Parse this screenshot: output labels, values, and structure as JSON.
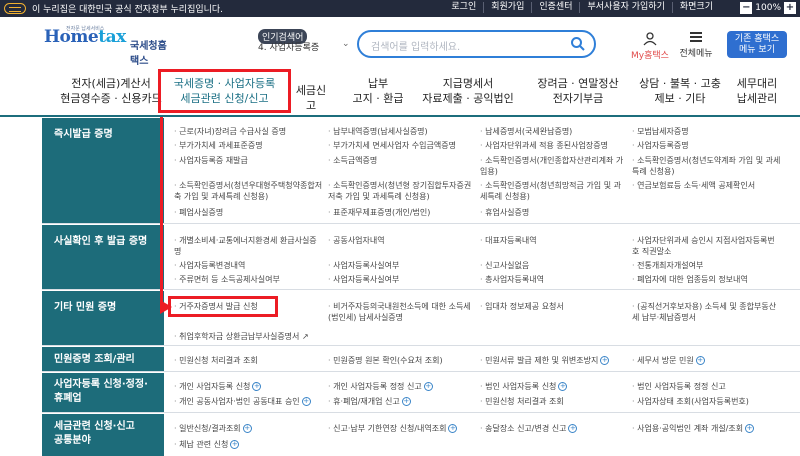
{
  "topbar": {
    "notice": "이 누리집은 대한민국 공식 전자정부 누리집입니다.",
    "links": [
      "로그인",
      "회원가입",
      "인증센터",
      "부서사용자 가입하기",
      "화면크기"
    ],
    "zoom_minus": "−",
    "zoom_value": "100%",
    "zoom_plus": "+"
  },
  "header": {
    "logo_text_home": "Home",
    "logo_text_tax": "tax",
    "logo_sub": "전자문 납세서비스",
    "logo_name": "국세청홈택스",
    "popular_tag": "인기검색어",
    "popular_keyword": "4.  사업자등록증",
    "search_placeholder": "검색어를 입력하세요.",
    "my_hometax": "My홈택스",
    "all_menu": "전체메뉴",
    "old_view_1": "기존 홈택스",
    "old_view_2": "메뉴 보기"
  },
  "nav": [
    {
      "line1": "전자(세금)계산서",
      "line2": "현금영수증 · 신용카드"
    },
    {
      "line1": "국세증명 · 사업자등록",
      "line2": "세금관련 신청/신고"
    },
    {
      "line1": "세금신고",
      "line2": ""
    },
    {
      "line1": "납부",
      "line2": "고지 · 환급"
    },
    {
      "line1": "지급명세서",
      "line2": "자료제출 · 공익법인"
    },
    {
      "line1": "장려금 · 연말정산",
      "line2": "전자기부금"
    },
    {
      "line1": "상담 · 불복 · 고충",
      "line2": "제보 · 기타"
    },
    {
      "line1": "세무대리",
      "line2": "납세관리"
    }
  ],
  "sections": {
    "s1": {
      "title": "즉시발급 증명",
      "items": [
        "근로(자녀)장려금 수급사실 증명",
        "납부내역증명(납세사실증명)",
        "납세증명서(국세완납증명)",
        "모범납세자증명",
        "부가가치세 과세표준증명",
        "부가가치세 면세사업자 수입금액증명",
        "사업자단위과세 적용 종된사업장증명",
        "사업자등록증명",
        "사업자등록증 재발급",
        "소득금액증명",
        "소득확인증명서(개인종합자산관리계좌 가입용)",
        "소득확인증명서(청년도약계좌 가입 및 과세특례 신청용)",
        "소득확인증명서(청년우대형주택청약종합저축 가입 및 과세특례 신청용)",
        "소득확인증명서(청년형 장기집합투자증권저축 가입 및 과세특례 신청용)",
        "소득확인증명서(청년희망적금 가입 및 과세특례 신청용)",
        "연금보험료등 소득·세액 공제확인서",
        "폐업사실증명",
        "표준재무제표증명(개인/법인)",
        "휴업사실증명"
      ]
    },
    "s2": {
      "title": "사실확인 후 발급 증명",
      "items": [
        "개별소비세·교통에너지환경세 환급사실증명",
        "공동사업자내역",
        "대표자등록내역",
        "사업자단위과세 승인시 지점사업자등록번호 직권말소",
        "사업자등록변경내역",
        "사업자등록사실여부",
        "신고사실없음",
        "전통개최자개설여부",
        "주류면허 등 소득공제사실여부",
        "사업자등록사실여부",
        "총사업자등록내역",
        "폐업자에 대한 업종등의 정보내역"
      ]
    },
    "s3": {
      "title": "기타 민원 증명",
      "items": [
        "거주자증명서 발급 신청",
        "비거주자등의국내원천소득에 대한 소득세(법인세) 납세사실증명",
        "임대차 정보제공 요청서",
        "(공직선거후보자용) 소득세 및 종합부동산세 납부·체납증명서",
        "취업후학자금 상환금납부사실증명서"
      ]
    },
    "s4": {
      "title": "민원증명 조회/관리",
      "items": [
        "민원신청 처리결과 조회",
        "민원증명 원본 확인(수요처 조회)",
        "민원서류 발급 제한 및 위변조방지",
        "세무서 방문 민원"
      ]
    },
    "s5": {
      "title_1": "사업자등록 신청·정정·",
      "title_2": "휴폐업",
      "items": [
        "개인 사업자등록 신청",
        "개인 사업자등록 정정 신고",
        "법인 사업자등록 신청",
        "법인 사업자등록 정정 신고",
        "개인 공동사업자·법인 공동대표 승인",
        "휴·폐업/재개업 신고",
        "민원신청 처리결과 조회",
        "사업자상태 조회(사업자등록번호)"
      ]
    },
    "s6": {
      "title_1": "세금관련 신청·신고",
      "title_2": "공통분야",
      "items": [
        "일반신청/결과조회",
        "신고·납부 기한연장 신청/내역조회",
        "송달장소 신고/변경 신고",
        "사업용·공익법인 계좌 개설/조회",
        "체납 관련 신청"
      ]
    }
  },
  "colors": {
    "accent": "#1d6c7a",
    "annotation": "#ec1c24",
    "brand_blue": "#2f6fd0"
  }
}
